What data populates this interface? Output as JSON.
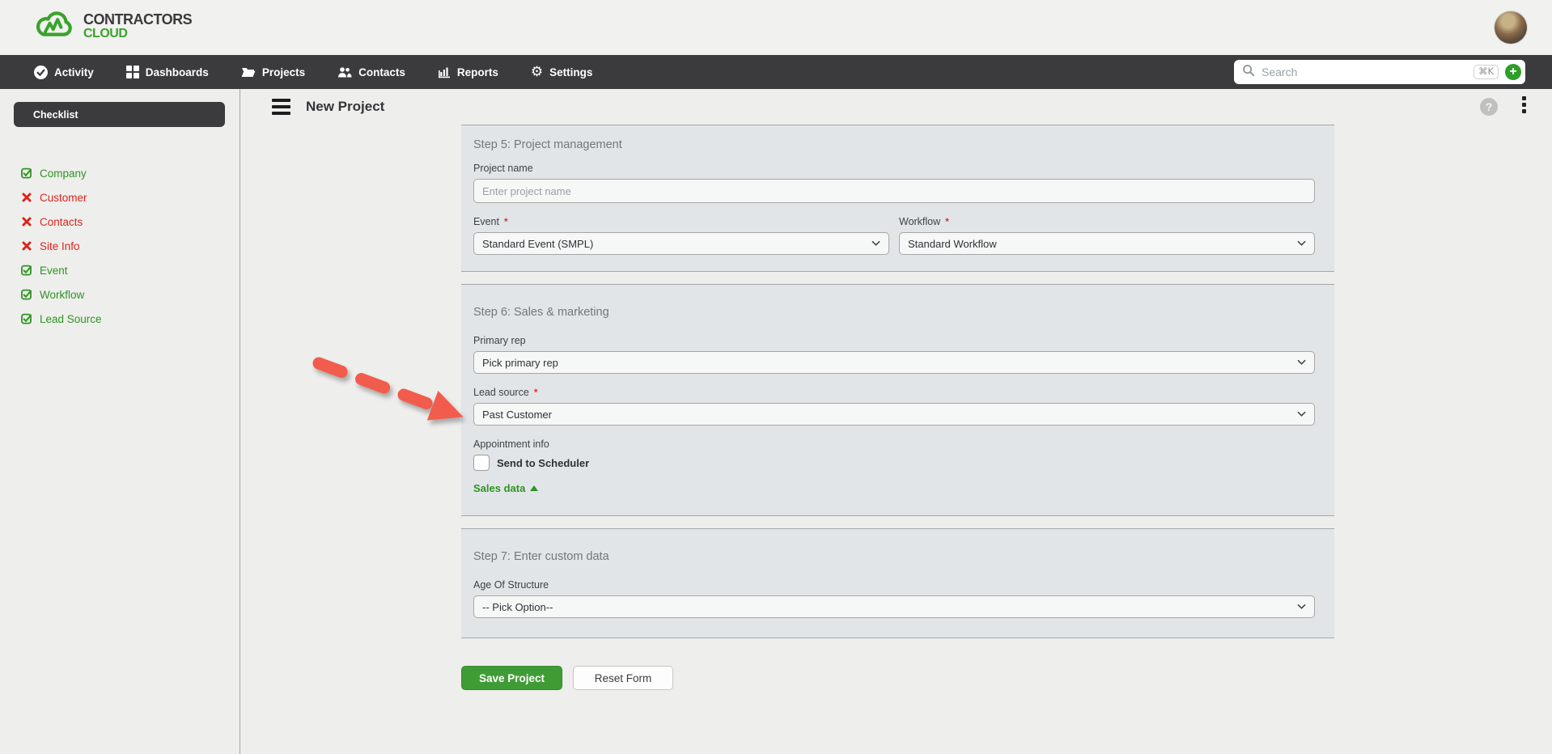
{
  "brand": {
    "line1": "CONTRACTORS",
    "line2": "CLOUD"
  },
  "nav": {
    "items": [
      {
        "label": "Activity",
        "icon": "check-circle-icon"
      },
      {
        "label": "Dashboards",
        "icon": "grid-icon"
      },
      {
        "label": "Projects",
        "icon": "folder-icon"
      },
      {
        "label": "Contacts",
        "icon": "people-icon"
      },
      {
        "label": "Reports",
        "icon": "bar-chart-icon"
      },
      {
        "label": "Settings",
        "icon": "gear-icon"
      }
    ],
    "search": {
      "placeholder": "Search",
      "shortcut": "⌘K",
      "plus_glyph": "+"
    }
  },
  "sidebar": {
    "title": "Checklist",
    "items": [
      {
        "label": "Company",
        "status": "complete"
      },
      {
        "label": "Customer",
        "status": "incomplete"
      },
      {
        "label": "Contacts",
        "status": "incomplete"
      },
      {
        "label": "Site Info",
        "status": "incomplete"
      },
      {
        "label": "Event",
        "status": "complete"
      },
      {
        "label": "Workflow",
        "status": "complete"
      },
      {
        "label": "Lead Source",
        "status": "complete"
      }
    ]
  },
  "page": {
    "title": "New Project",
    "help_glyph": "?"
  },
  "form": {
    "required_mark": "*",
    "steps": [
      {
        "title": "Step 5: Project management",
        "project_name": {
          "label": "Project name",
          "placeholder": "Enter project name",
          "value": ""
        },
        "event": {
          "label": "Event",
          "value": "Standard Event (SMPL)"
        },
        "workflow": {
          "label": "Workflow",
          "value": "Standard Workflow"
        }
      },
      {
        "title": "Step 6: Sales & marketing",
        "primary_rep": {
          "label": "Primary rep",
          "value": "Pick primary rep"
        },
        "lead_source": {
          "label": "Lead source",
          "value": "Past Customer"
        },
        "appointment": {
          "label": "Appointment info",
          "checkbox_label": "Send to Scheduler",
          "checked": false
        },
        "sales_data": {
          "label": "Sales data"
        }
      },
      {
        "title": "Step 7: Enter custom data",
        "age_of_structure": {
          "label": "Age Of Structure",
          "value": "-- Pick Option--"
        }
      }
    ],
    "actions": {
      "save": "Save Project",
      "reset": "Reset Form"
    }
  },
  "colors": {
    "green": "#2f9422",
    "logo_green": "#39a32b",
    "button_green": "#3f9c35",
    "red": "#da251c",
    "nav_bg": "#3b3b3d",
    "section_bg": "#e1e5e8",
    "arrow": "#f25c4c"
  }
}
